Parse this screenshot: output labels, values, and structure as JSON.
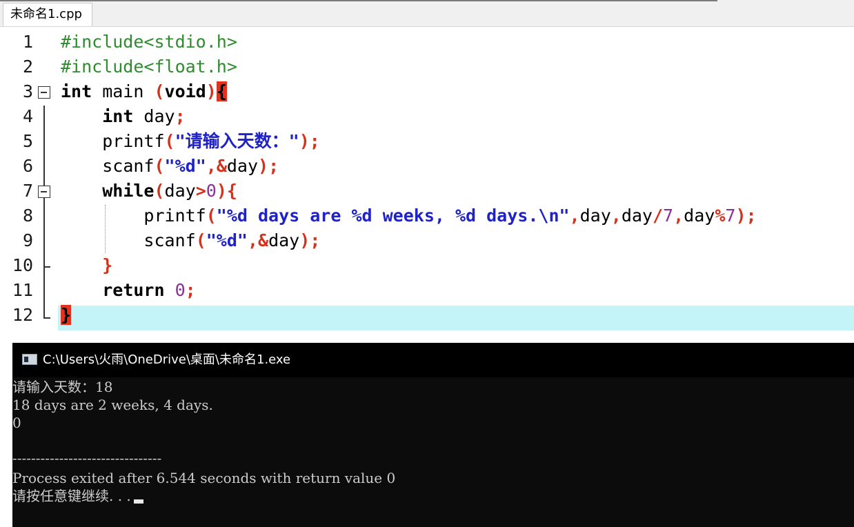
{
  "editor": {
    "tab_label": "未命名1.cpp",
    "line_numbers": [
      "1",
      "2",
      "3",
      "4",
      "5",
      "6",
      "7",
      "8",
      "9",
      "10",
      "11",
      "12"
    ],
    "code": {
      "l1": "#include<stdio.h>",
      "l2": "#include<float.h>",
      "l3_kw": "int",
      "l3_name": " main ",
      "l3_paren_open": "(",
      "l3_void": "void",
      "l3_paren_close": ")",
      "l3_brace": "{",
      "l4_kw": "int",
      "l4_var": " day",
      "l4_semi": ";",
      "l5_fn": "printf",
      "l5_open": "(",
      "l5_str": "\"请输入天数：\"",
      "l5_close": ");",
      "l6_fn": "scanf",
      "l6_open": "(",
      "l6_str": "\"%d\"",
      "l6_comma": ",&",
      "l6_var": "day",
      "l6_close": ");",
      "l7_kw": "while",
      "l7_open": "(",
      "l7_var": "day",
      "l7_gt": ">",
      "l7_num": "0",
      "l7_close": "){",
      "l8_fn": "printf",
      "l8_open": "(",
      "l8_str": "\"%d days are %d weeks, %d days.\\n\"",
      "l8_c1": ",",
      "l8_v1": "day",
      "l8_c2": ",",
      "l8_v2": "day",
      "l8_div": "/",
      "l8_n7a": "7",
      "l8_c3": ",",
      "l8_v3": "day",
      "l8_mod": "%",
      "l8_n7b": "7",
      "l8_close": ");",
      "l9_fn": "scanf",
      "l9_open": "(",
      "l9_str": "\"%d\"",
      "l9_comma": ",&",
      "l9_var": "day",
      "l9_close": ");",
      "l10_brace": "}",
      "l11_kw": "return",
      "l11_num": "0",
      "l11_semi": ";",
      "l12_brace": "}"
    }
  },
  "console": {
    "title": "C:\\Users\\火雨\\OneDrive\\桌面\\未命名1.exe",
    "lines": [
      "请输入天数：18",
      "18 days are 2 weeks, 4 days.",
      "0",
      "",
      "--------------------------------",
      "Process exited after 6.544 seconds with return value 0",
      "请按任意键继续. . ."
    ]
  },
  "colors": {
    "preprocessor": "#2e8b2e",
    "symbol": "#d4321c",
    "string": "#1e22c8",
    "number": "#8a2f9a",
    "current_line": "#c4f4f8",
    "brace_match": "#e6301e",
    "console_bg": "#0c0c0c"
  }
}
